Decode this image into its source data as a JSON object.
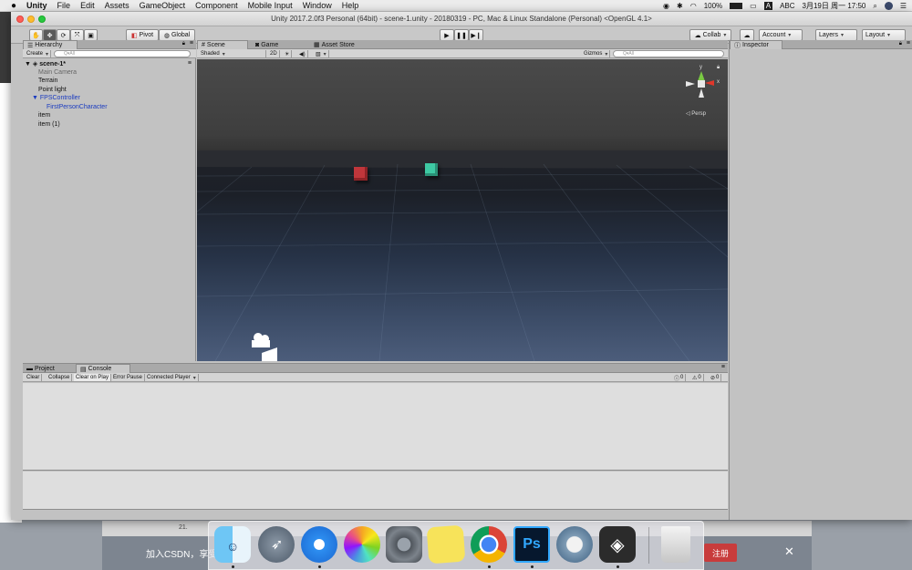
{
  "menubar": {
    "apple": "",
    "app": "Unity",
    "items": [
      "File",
      "Edit",
      "Assets",
      "GameObject",
      "Component",
      "Mobile Input",
      "Window",
      "Help"
    ],
    "battery": "100%",
    "input": "ABC",
    "datetime": "3月19日 周一  17:50"
  },
  "window": {
    "title": "Unity 2017.2.0f3 Personal (64bit) - scene-1.unity - 20180319 - PC, Mac & Linux Standalone (Personal) <OpenGL 4.1>"
  },
  "toolbar": {
    "pivot": "Pivot",
    "global": "Global",
    "collab": "Collab",
    "account": "Account",
    "layers": "Layers",
    "layout": "Layout"
  },
  "hierarchy": {
    "tab": "Hierarchy",
    "create": "Create",
    "search_placeholder": "Q▾All",
    "scene": "scene-1*",
    "items": [
      "Main Camera",
      "Terrain",
      "Point light",
      "FPSController",
      "FirstPersonCharacter",
      "item",
      "item (1)"
    ]
  },
  "scene_view": {
    "tabs": [
      "Scene",
      "Game",
      "Asset Store"
    ],
    "shading": "Shaded",
    "mode_2d": "2D",
    "gizmos": "Gizmos",
    "search_placeholder": "Q▾All",
    "persp": "◁ Persp",
    "axis_x": "x",
    "axis_y": "y",
    "cube_colors": [
      "#c0363b",
      "#3ec9a3"
    ]
  },
  "inspector": {
    "tab": "Inspector"
  },
  "bottom": {
    "tabs": [
      "Project",
      "Console"
    ],
    "buttons": [
      "Clear",
      "Collapse",
      "Clear on Play",
      "Error Pause",
      "Connected Player"
    ],
    "counts": [
      "0",
      "0",
      "0"
    ]
  },
  "dock": {
    "apps": [
      "finder-icon",
      "launchpad-icon",
      "safari-icon",
      "photos-icon",
      "system-preferences-icon",
      "stickies-icon",
      "chrome-icon",
      "photoshop-icon",
      "mirror-icon",
      "unity-icon",
      "trash-icon"
    ],
    "ps_label": "Ps"
  },
  "csdn": {
    "text": "加入CSDN，享受",
    "register": "注册",
    "close": "✕",
    "page_num": "21."
  }
}
